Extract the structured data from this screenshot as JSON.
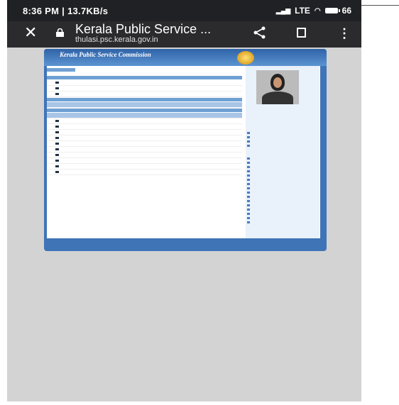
{
  "status_bar": {
    "time_speed": "8:36 PM | 13.7KB/s",
    "network": "LTE",
    "battery": "66"
  },
  "browser": {
    "close_icon": "close-icon",
    "lock_icon": "lock-icon",
    "page_title": "Kerala Public Service ...",
    "url": "thulasi.psc.kerala.gov.in",
    "share_icon": "share-icon",
    "bookmark_icon": "bookmark-icon",
    "menu_icon": "more-vert-icon"
  },
  "webpage": {
    "site_title": "Kerala Public Service Commission"
  },
  "colors": {
    "status_bg": "#202124",
    "toolbar_bg": "#2b2b2e",
    "page_bg": "#d3d3d3",
    "site_blue": "#3f74b7"
  }
}
